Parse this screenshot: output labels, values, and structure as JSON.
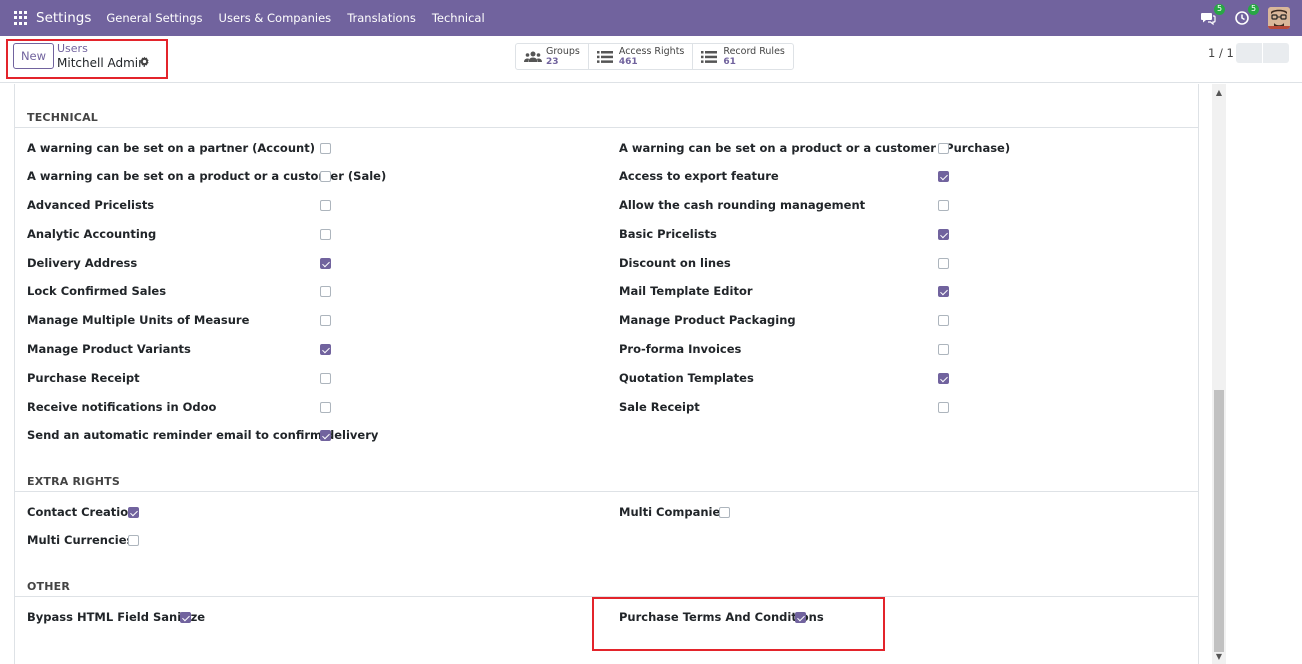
{
  "topbar": {
    "app_title": "Settings",
    "menu": [
      "General Settings",
      "Users & Companies",
      "Translations",
      "Technical"
    ],
    "messages_badge": "5",
    "activities_badge": "5"
  },
  "control_panel": {
    "new_label": "New",
    "breadcrumb_parent": "Users",
    "breadcrumb_current": "Mitchell Admin",
    "smart_buttons": [
      {
        "label": "Groups",
        "value": "23",
        "icon": "users-icon"
      },
      {
        "label": "Access Rights",
        "value": "461",
        "icon": "list-icon"
      },
      {
        "label": "Record Rules",
        "value": "61",
        "icon": "list-icon"
      }
    ],
    "pager": "1 / 1"
  },
  "sections": {
    "technical": {
      "title": "TECHNICAL",
      "left": [
        {
          "label": "A warning can be set on a partner (Account)",
          "checked": false
        },
        {
          "label": "A warning can be set on a product or a customer (Sale)",
          "checked": false
        },
        {
          "label": "Advanced Pricelists",
          "checked": false
        },
        {
          "label": "Analytic Accounting",
          "checked": false
        },
        {
          "label": "Delivery Address",
          "checked": true
        },
        {
          "label": "Lock Confirmed Sales",
          "checked": false
        },
        {
          "label": "Manage Multiple Units of Measure",
          "checked": false
        },
        {
          "label": "Manage Product Variants",
          "checked": true
        },
        {
          "label": "Purchase Receipt",
          "checked": false
        },
        {
          "label": "Receive notifications in Odoo",
          "checked": false
        },
        {
          "label": "Send an automatic reminder email to confirm delivery",
          "checked": true
        }
      ],
      "right": [
        {
          "label": "A warning can be set on a product or a customer (Purchase)",
          "checked": false
        },
        {
          "label": "Access to export feature",
          "checked": true
        },
        {
          "label": "Allow the cash rounding management",
          "checked": false
        },
        {
          "label": "Basic Pricelists",
          "checked": true
        },
        {
          "label": "Discount on lines",
          "checked": false
        },
        {
          "label": "Mail Template Editor",
          "checked": true
        },
        {
          "label": "Manage Product Packaging",
          "checked": false
        },
        {
          "label": "Pro-forma Invoices",
          "checked": false
        },
        {
          "label": "Quotation Templates",
          "checked": true
        },
        {
          "label": "Sale Receipt",
          "checked": false
        }
      ]
    },
    "extra_rights": {
      "title": "EXTRA RIGHTS",
      "left": [
        {
          "label": "Contact Creation",
          "checked": true
        },
        {
          "label": "Multi Currencies",
          "checked": false
        }
      ],
      "right": [
        {
          "label": "Multi Companies",
          "checked": false
        }
      ]
    },
    "other": {
      "title": "OTHER",
      "left": [
        {
          "label": "Bypass HTML Field Sanitize",
          "checked": true
        }
      ],
      "right": [
        {
          "label": "Purchase Terms And Conditions",
          "checked": true
        }
      ]
    }
  },
  "colors": {
    "brand": "#71639e",
    "highlight": "#e3242b",
    "badge": "#28a745"
  }
}
